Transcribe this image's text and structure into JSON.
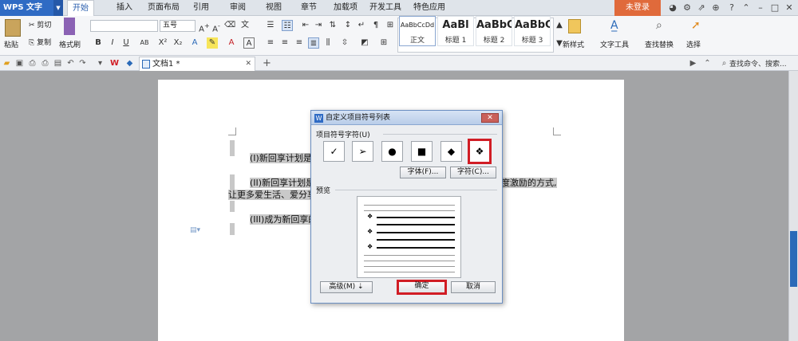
{
  "app": {
    "name": "WPS 文字",
    "tabs": [
      "开始",
      "插入",
      "页面布局",
      "引用",
      "审阅",
      "视图",
      "章节",
      "加载项",
      "开发工具",
      "特色应用"
    ],
    "active_tab": "开始",
    "login": "未登录"
  },
  "ribbon": {
    "paste": "粘贴",
    "cut": "剪切",
    "copy": "复制",
    "format_painter": "格式刷",
    "font_size": "五号",
    "styles": [
      {
        "preview": "AaBbCcDd",
        "label": "正文"
      },
      {
        "preview": "AaBl",
        "label": "标题 1"
      },
      {
        "preview": "AaBbC",
        "label": "标题 2"
      },
      {
        "preview": "AaBbC",
        "label": "标题 3"
      }
    ],
    "new_style": "新样式",
    "text_tools": "文字工具",
    "find_replace": "查找替换",
    "select": "选择"
  },
  "quickbar": {
    "doc_tab": "文档1 *",
    "search_placeholder": "查找命令、搜索..."
  },
  "document": {
    "line1": "(I)新回享计划是",
    "line2a": "(II)新回享计划是",
    "line2b": "让更多爱生活、爱分享",
    "line2c": "度激励的方式,",
    "line3": "(III)成为新回享的"
  },
  "dialog": {
    "title": "自定义项目符号列表",
    "group_symbols": "项目符号字符(U)",
    "symbols": [
      "✓",
      "➢",
      "●",
      "■",
      "◆",
      "❖"
    ],
    "selected_symbol_index": 5,
    "font_button": "字体(F)...",
    "char_button": "字符(C)...",
    "group_preview": "预览",
    "preview_bullet": "❖",
    "advanced_button": "高级(M) ⇣",
    "ok_button": "确定",
    "cancel_button": "取消"
  }
}
